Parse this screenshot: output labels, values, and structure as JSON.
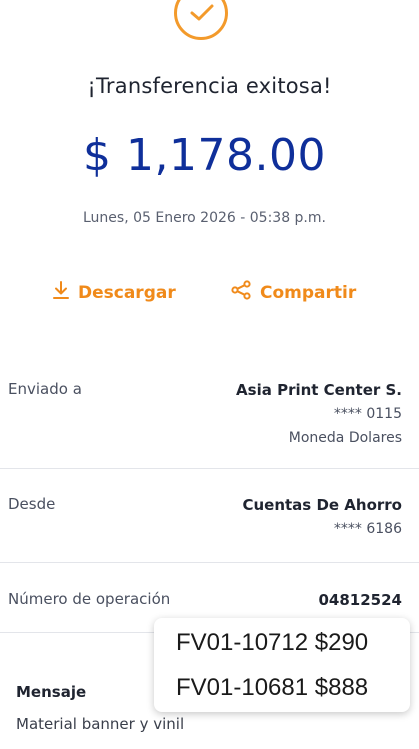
{
  "header": {
    "status_icon": "checkmark-circle-icon",
    "title": "¡Transferencia exitosa!",
    "amount": "$ 1,178.00",
    "datetime": "Lunes, 05 Enero 2026 - 05:38 p.m."
  },
  "actions": {
    "download_label": "Descargar",
    "download_icon": "download-icon",
    "share_label": "Compartir",
    "share_icon": "share-icon"
  },
  "details": {
    "sent_to": {
      "label": "Enviado a",
      "name": "Asia Print Center S.",
      "account": "**** 0115",
      "currency": "Moneda Dolares"
    },
    "from": {
      "label": "Desde",
      "name": "Cuentas De Ahorro",
      "account": "**** 6186"
    },
    "operation": {
      "label": "Número de operación",
      "value": "04812524"
    },
    "message": {
      "label": "Mensaje",
      "text": "Material banner y vinil"
    }
  },
  "popup": {
    "lines": [
      "FV01-10712 $290",
      "FV01-10681 $888"
    ]
  },
  "colors": {
    "accent": "#f39a2b",
    "amount": "#0f2f9a"
  }
}
